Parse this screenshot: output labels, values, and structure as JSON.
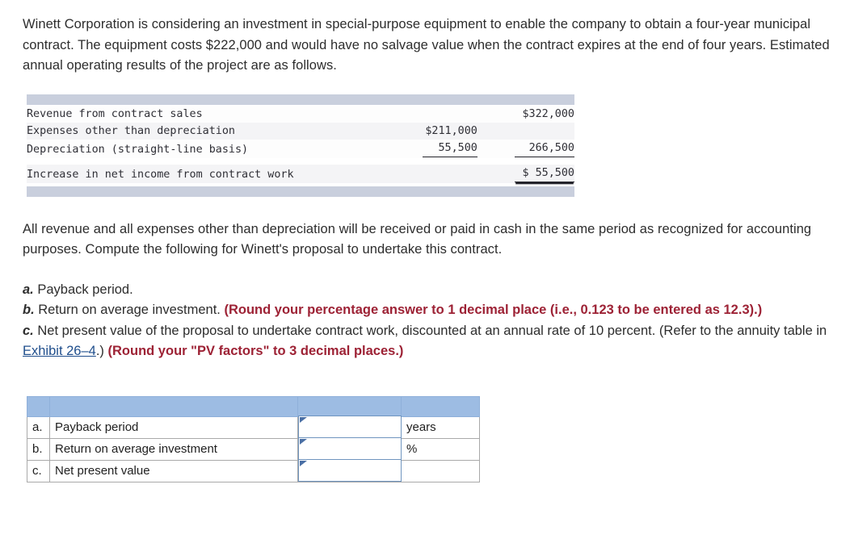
{
  "intro": {
    "paragraph": "Winett Corporation is considering an investment in special-purpose equipment to enable the company to obtain a four-year municipal contract. The equipment costs $222,000 and would have no salvage value when the contract expires at the end of four years. Estimated annual operating results of the project are as follows."
  },
  "financials": {
    "rows": [
      {
        "label": "Revenue from contract sales",
        "col1": "",
        "col2": "$322,000"
      },
      {
        "label": "Expenses other than depreciation",
        "col1": "$211,000",
        "col2": ""
      },
      {
        "label": "Depreciation (straight-line basis)",
        "col1": "55,500",
        "col2": "266,500"
      },
      {
        "label": "Increase in net income from contract work",
        "col1": "",
        "col2": "$ 55,500"
      }
    ]
  },
  "middle": {
    "paragraph": "All revenue and all expenses other than depreciation will be received or paid in cash in the same period as recognized for accounting purposes. Compute the following for Winett's proposal to undertake this contract."
  },
  "requirements": {
    "a_marker": "a.",
    "a_text": " Payback period.",
    "b_marker": "b.",
    "b_text": " Return on average investment. ",
    "b_note": "(Round your percentage answer to 1 decimal place (i.e., 0.123 to be entered as 12.3).)",
    "c_marker": "c.",
    "c_text": " Net present value of the proposal to undertake contract work, discounted at an annual rate of 10 percent. (Refer to the annuity table in ",
    "c_link": "Exhibit 26–4",
    "c_text_after": ".) ",
    "c_note": "(Round your \"PV factors\" to 3 decimal places.)"
  },
  "answer_table": {
    "rows": [
      {
        "key": "a.",
        "desc": "Payback period",
        "value": "",
        "unit": "years"
      },
      {
        "key": "b.",
        "desc": "Return on average investment",
        "value": "",
        "unit": "%"
      },
      {
        "key": "c.",
        "desc": "Net present value",
        "value": "",
        "unit": ""
      }
    ]
  },
  "colors": {
    "header_blue": "#9dbce3",
    "note_red": "#9d2235",
    "link_blue": "#1f4e8c",
    "fin_bar_gray": "#c9cfdd",
    "input_border": "#6f94bf"
  }
}
